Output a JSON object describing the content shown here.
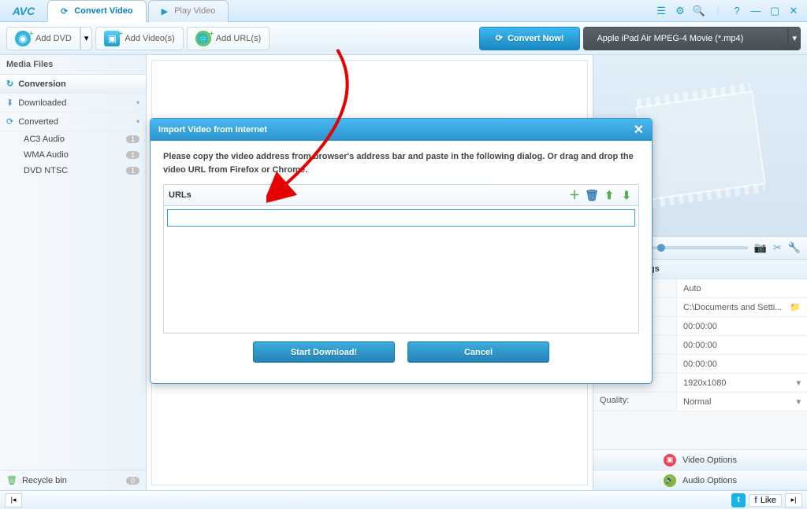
{
  "app": {
    "logo": "AVC"
  },
  "tabs": {
    "convert": "Convert Video",
    "play": "Play Video"
  },
  "toolbar": {
    "add_dvd": "Add DVD",
    "add_videos": "Add Video(s)",
    "add_urls": "Add URL(s)",
    "convert_now": "Convert Now!",
    "profile": "Apple iPad Air MPEG-4 Movie (*.mp4)"
  },
  "sidebar": {
    "head": "Media Files",
    "conversion": "Conversion",
    "downloaded": "Downloaded",
    "converted": "Converted",
    "subs": [
      {
        "label": "AC3 Audio",
        "badge": "1"
      },
      {
        "label": "WMA Audio",
        "badge": "1"
      },
      {
        "label": "DVD NTSC",
        "badge": "1"
      }
    ],
    "recycle": "Recycle bin",
    "recycle_badge": "0"
  },
  "settings": {
    "head": "Basic Settings",
    "rows": {
      "auto": "Auto",
      "path": "C:\\Documents and Setti...",
      "t1": "00:00:00",
      "t2": "00:00:00",
      "t3": "00:00:00",
      "res": "1920x1080",
      "quality_label": "Quality:",
      "quality": "Normal"
    },
    "video_opts": "Video Options",
    "audio_opts": "Audio Options"
  },
  "dialog": {
    "title": "Import Video from Internet",
    "desc": "Please copy the video address from browser's address bar and paste in the following dialog. Or drag and drop the video URL from Firefox or Chrome.",
    "urls_label": "URLs",
    "input_value": "",
    "start": "Start Download!",
    "cancel": "Cancel"
  },
  "bottom": {
    "like": "Like"
  }
}
